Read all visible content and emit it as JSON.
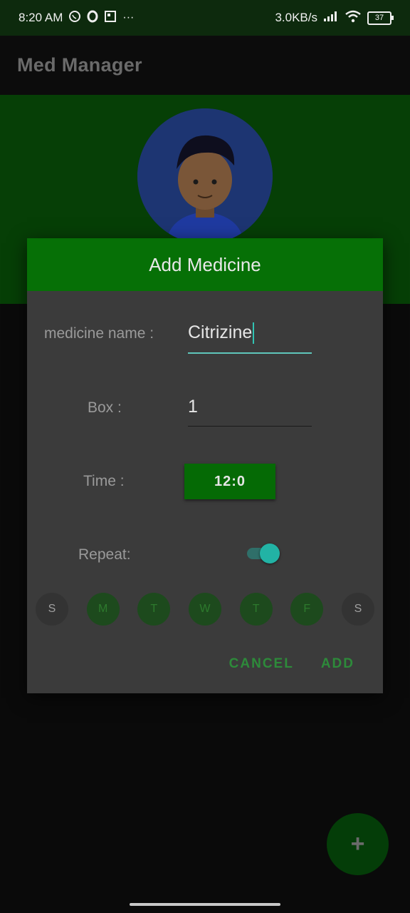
{
  "status_bar": {
    "time": "8:20 AM",
    "network_speed": "3.0KB/s",
    "battery": "37",
    "icons": [
      "whatsapp-icon",
      "opera-icon",
      "news-icon",
      "more-icon",
      "signal-icon",
      "wifi-icon",
      "battery-icon"
    ]
  },
  "app": {
    "title": "Med Manager"
  },
  "dialog": {
    "title": "Add Medicine",
    "medicine_name_label": "medicine name :",
    "medicine_name_value": "Citrizine",
    "box_label": "Box :",
    "box_value": "1",
    "time_label": "Time :",
    "time_value": "12:0",
    "repeat_label": "Repeat:",
    "repeat_enabled": true,
    "days": [
      {
        "label": "S",
        "selected": false
      },
      {
        "label": "M",
        "selected": true
      },
      {
        "label": "T",
        "selected": true
      },
      {
        "label": "W",
        "selected": true
      },
      {
        "label": "T",
        "selected": true
      },
      {
        "label": "F",
        "selected": true
      },
      {
        "label": "S",
        "selected": false
      }
    ],
    "cancel_label": "CANCEL",
    "add_label": "ADD"
  },
  "fab": {
    "label": "+"
  },
  "colors": {
    "brand_green": "#067006",
    "accent_teal": "#22b3a5",
    "dialog_bg": "#3b3b3b"
  }
}
